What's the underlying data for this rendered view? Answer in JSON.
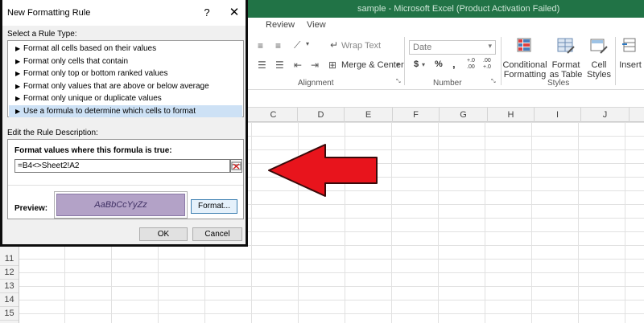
{
  "excel": {
    "window_title": "sample - Microsoft Excel (Product Activation Failed)",
    "tabs": [
      "Review",
      "View"
    ],
    "ribbon": {
      "wrap_text": "Wrap Text",
      "merge_center": "Merge & Center",
      "number_format": "Date",
      "currency": "$",
      "percent": "%",
      "comma": ",",
      "inc_decimal": "+.0 .00",
      "dec_decimal": ".00 +.0",
      "conditional_formatting_line1": "Conditional",
      "conditional_formatting_line2": "Formatting",
      "format_as_table_line1": "Format",
      "format_as_table_line2": "as Table",
      "cell_styles_line1": "Cell",
      "cell_styles_line2": "Styles",
      "insert": "Insert",
      "group_alignment": "Alignment",
      "group_number": "Number",
      "group_styles": "Styles"
    },
    "columns": [
      "C",
      "D",
      "E",
      "F",
      "G",
      "H",
      "I",
      "J"
    ],
    "rows": [
      "11",
      "12",
      "13",
      "14",
      "15"
    ]
  },
  "dialog": {
    "title": "New Formatting Rule",
    "help": "?",
    "close": "✕",
    "rule_type_label": "Select a Rule Type:",
    "rule_types": [
      "Format all cells based on their values",
      "Format only cells that contain",
      "Format only top or bottom ranked values",
      "Format only values that are above or below average",
      "Format only unique or duplicate values",
      "Use a formula to determine which cells to format"
    ],
    "selected_rule_index": 5,
    "description_label": "Edit the Rule Description:",
    "formula_label": "Format values where this formula is true:",
    "formula_value": "=B4<>Sheet2!A2",
    "preview_label": "Preview:",
    "preview_text": "AaBbCcYyZz",
    "format_button": "Format...",
    "ok_button": "OK",
    "cancel_button": "Cancel"
  },
  "colors": {
    "arrow_fill": "#e8141c",
    "preview_fill": "#b3a2c7",
    "excel_green": "#217346",
    "selection_blue": "#cde1f5"
  }
}
